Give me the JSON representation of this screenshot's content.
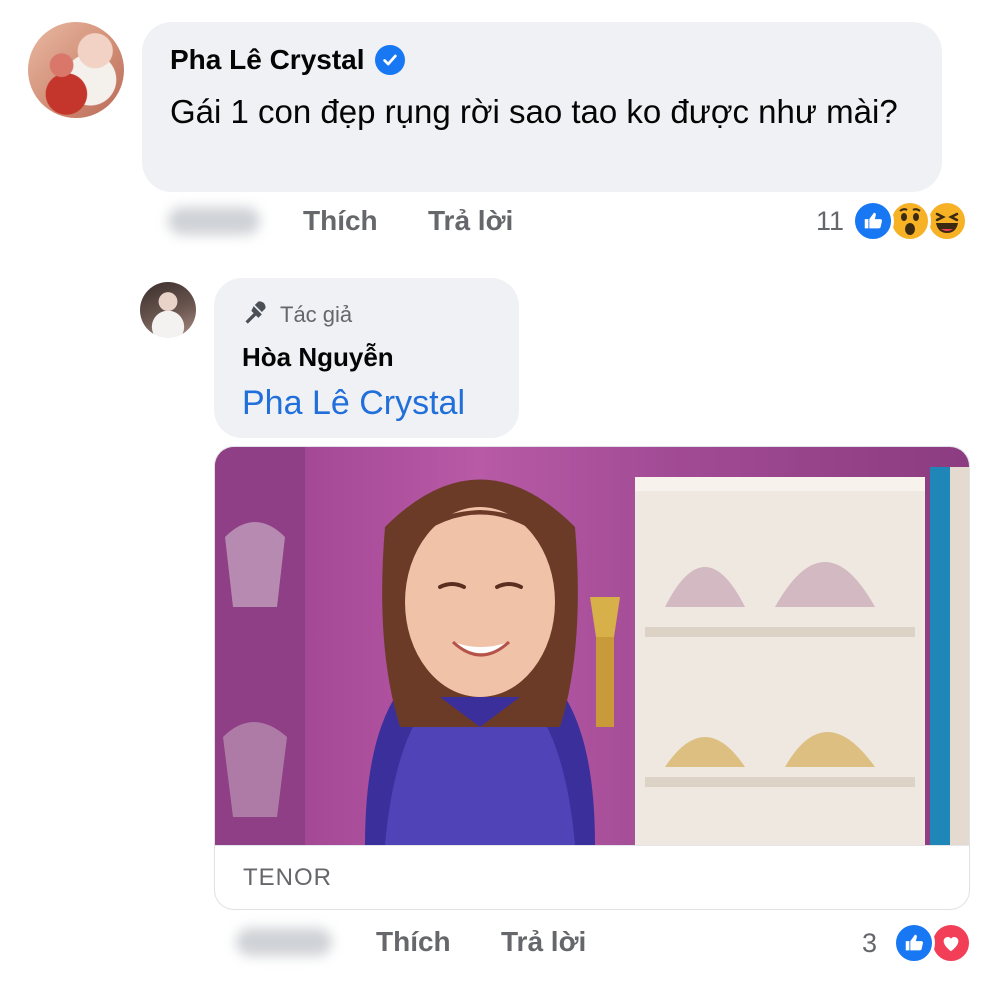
{
  "comments": [
    {
      "author": "Pha Lê Crystal",
      "verified": true,
      "text": "Gái 1 con đẹp rụng rời sao tao ko được như mài?",
      "actions": {
        "like": "Thích",
        "reply": "Trả lời"
      },
      "reaction_count": "11",
      "reactions": [
        "like-icon",
        "wow-icon",
        "haha-icon"
      ]
    }
  ],
  "reply": {
    "badge": "Tác giả",
    "author": "Hòa Nguyễn",
    "mention": "Pha Lê Crystal",
    "gif_source": "TENOR",
    "actions": {
      "like": "Thích",
      "reply": "Trả lời"
    },
    "reaction_count": "3",
    "reactions": [
      "like-icon",
      "love-icon"
    ]
  },
  "colors": {
    "bubble_bg": "#eff1f4",
    "accent_blue": "#1877f2",
    "mention_blue": "#216fdb",
    "secondary_text": "#65676b",
    "love_red": "#f33e58",
    "wow_yellow": "#f7b125"
  }
}
